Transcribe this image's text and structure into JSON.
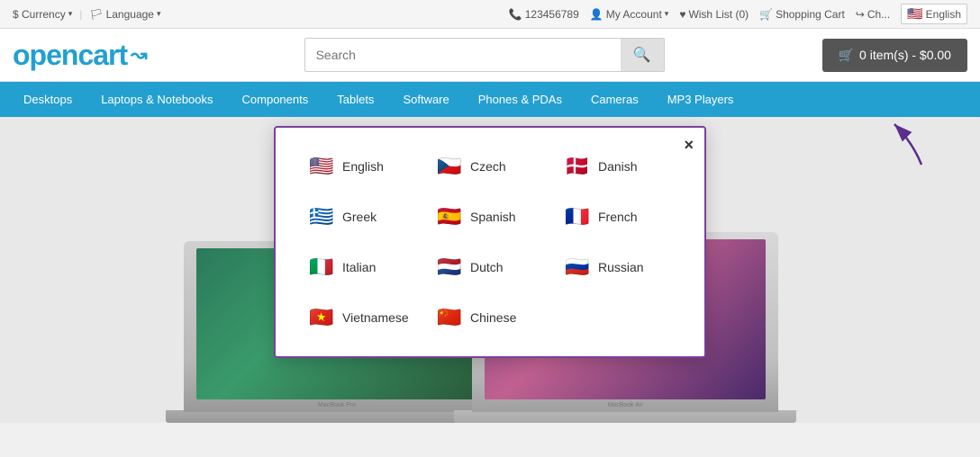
{
  "topbar": {
    "currency_label": "$ Currency",
    "language_label": "Language",
    "phone": "123456789",
    "my_account": "My Account",
    "wish_list": "Wish List (0)",
    "shopping_cart": "Shopping Cart",
    "checkout": "Ch...",
    "current_lang": "English"
  },
  "header": {
    "logo_text": "opencart",
    "logo_icon": "→",
    "search_placeholder": "Search",
    "search_btn_icon": "🔍",
    "cart_label": "0 item(s) - $0.00"
  },
  "nav": {
    "items": [
      {
        "label": "Desktops"
      },
      {
        "label": "Laptops & Notebooks"
      },
      {
        "label": "Components"
      },
      {
        "label": "Tablets"
      },
      {
        "label": "Software"
      },
      {
        "label": "Phones & PDAs"
      },
      {
        "label": "Cameras"
      },
      {
        "label": "MP3 Players"
      }
    ]
  },
  "modal": {
    "close_label": "×",
    "languages": [
      {
        "name": "English",
        "flag_emoji": "🇺🇸",
        "flag_type": "us"
      },
      {
        "name": "Czech",
        "flag_emoji": "🇨🇿",
        "flag_type": "cz"
      },
      {
        "name": "Danish",
        "flag_emoji": "🇩🇰",
        "flag_type": "dk"
      },
      {
        "name": "Greek",
        "flag_emoji": "🇬🇷",
        "flag_type": "gr"
      },
      {
        "name": "Spanish",
        "flag_emoji": "🇪🇸",
        "flag_type": "es"
      },
      {
        "name": "French",
        "flag_emoji": "🇫🇷",
        "flag_type": "fr"
      },
      {
        "name": "Italian",
        "flag_emoji": "🇮🇹",
        "flag_type": "it"
      },
      {
        "name": "Dutch",
        "flag_emoji": "🇳🇱",
        "flag_type": "nl"
      },
      {
        "name": "Russian",
        "flag_emoji": "🇷🇺",
        "flag_type": "ru"
      },
      {
        "name": "Vietnamese",
        "flag_emoji": "🇻🇳",
        "flag_type": "vn"
      },
      {
        "name": "Chinese",
        "flag_emoji": "🇨🇳",
        "flag_type": "cn"
      }
    ]
  },
  "laptops": {
    "label1": "MacBook Pro",
    "label2": "MacBook Air"
  }
}
